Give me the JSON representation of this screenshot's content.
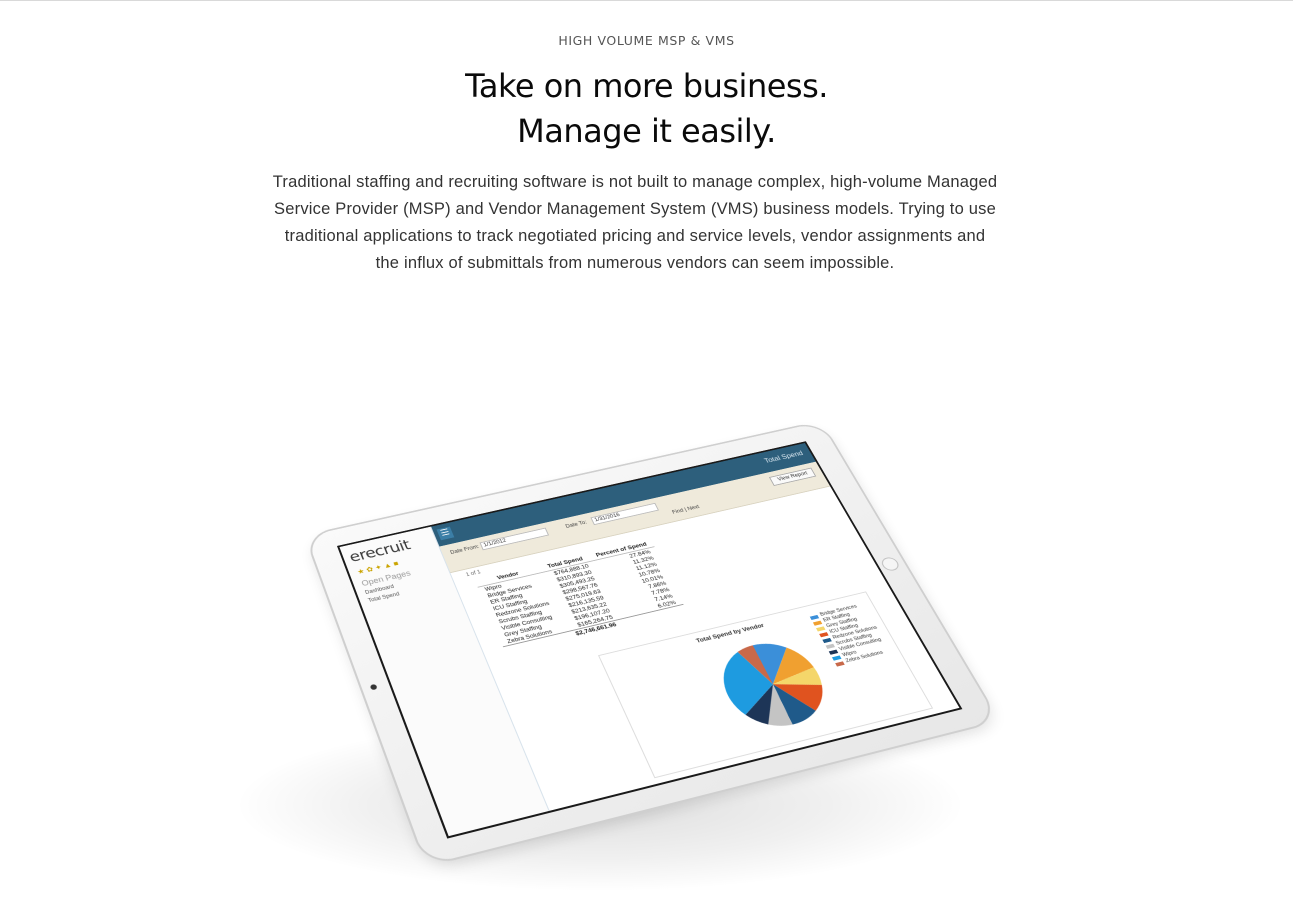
{
  "section": {
    "eyebrow": "HIGH VOLUME MSP & VMS",
    "headline_line1": "Take on more business.",
    "headline_line2": "Manage it easily.",
    "body": "Traditional staffing and recruiting software is not built to manage complex, high-volume Managed Service Provider (MSP) and Vendor Management System (VMS) business models. Trying to use traditional applications to track negotiated pricing and service levels, vendor assignments and the influx of submittals from numerous vendors can seem impossible."
  },
  "tablet_app": {
    "logo": "erecruit",
    "open_pages_label": "Open Pages",
    "side_links": [
      "Dashboard",
      "Total Spend"
    ],
    "screen_title": "Total Spend",
    "toolbar": {
      "date_from_label": "Date From:",
      "date_from_value": "1/1/2012",
      "date_to_label": "Date To:",
      "date_to_value": "1/31/2016",
      "find_label": "Find | Next",
      "view_report": "View Report"
    },
    "pager": "1 of 1",
    "table": {
      "headers": [
        "Vendor",
        "Total Spend",
        "Percent of Spend"
      ],
      "rows": [
        [
          "Wipro",
          "$764,888.10",
          "27.84%"
        ],
        [
          "Bridge Services",
          "$310,893.30",
          "11.32%"
        ],
        [
          "ER Staffing",
          "$305,493.25",
          "11.12%"
        ],
        [
          "ICU Staffing",
          "$298,567.76",
          "10.78%"
        ],
        [
          "Redzone Solutions",
          "$275,019.63",
          "10.01%"
        ],
        [
          "Scrubs Staffing",
          "$216,135.59",
          "7.86%"
        ],
        [
          "Visible Consulting",
          "$213,635.22",
          "7.78%"
        ],
        [
          "Grey Staffing",
          "$196,107.20",
          "7.14%"
        ],
        [
          "Zebra Solutions",
          "$165,264.75",
          "6.02%"
        ]
      ],
      "total": [
        "",
        "$2,746,661.96",
        ""
      ]
    },
    "chart_title": "Total Spend by Vendor",
    "chart_data": {
      "type": "pie",
      "title": "Total Spend by Vendor",
      "categories": [
        "Bridge Services",
        "ER Staffing",
        "Grey Staffing",
        "ICU Staffing",
        "Redzone Solutions",
        "Scrubs Staffing",
        "Visible Consulting",
        "Wipro",
        "Zebra Solutions"
      ],
      "values": [
        11.32,
        11.12,
        7.14,
        10.78,
        10.01,
        7.86,
        7.78,
        27.84,
        6.02
      ],
      "colors": [
        "#3b8fd9",
        "#f0a030",
        "#f4d66a",
        "#e0531f",
        "#1f5a8a",
        "#c4c4c4",
        "#1d3557",
        "#1e9be0",
        "#c8694a"
      ],
      "legend": "right"
    }
  }
}
